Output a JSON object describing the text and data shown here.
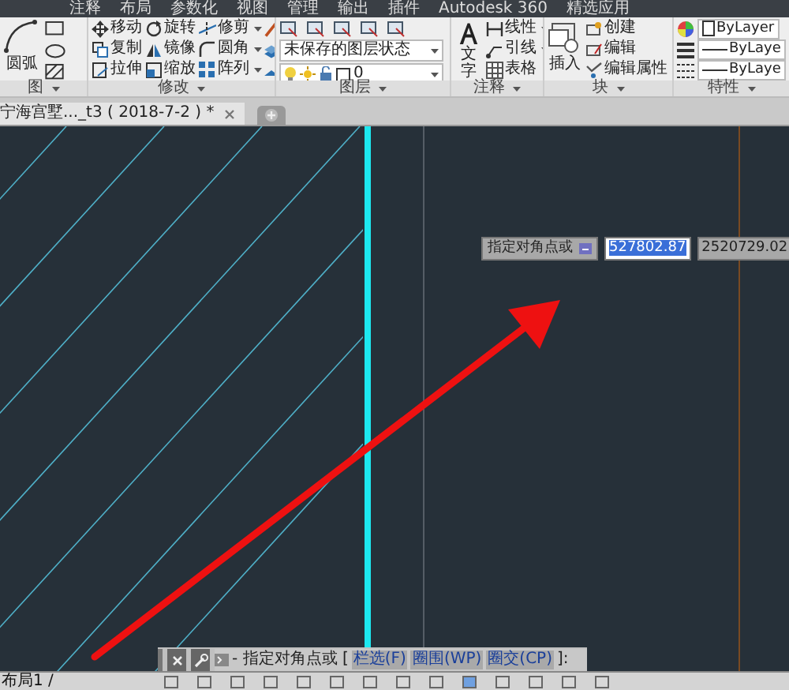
{
  "menu_tabs": [
    "注释",
    "布局",
    "参数化",
    "视图",
    "管理",
    "输出",
    "插件",
    "Autodesk 360",
    "精选应用"
  ],
  "ribbon": {
    "panels": [
      {
        "kind": "draw",
        "title": "图",
        "tools": [
          "圆弧"
        ]
      },
      {
        "kind": "modify",
        "title": "修改",
        "tools": [
          "移动",
          "旋转",
          "修剪",
          "复制",
          "镜像",
          "圆角",
          "拉伸",
          "缩放",
          "阵列"
        ]
      },
      {
        "kind": "layer",
        "title": "图层",
        "state": "未保存的图层状态",
        "layer": "0"
      },
      {
        "kind": "annotation",
        "title": "注释",
        "big": "文字",
        "tools": [
          "线性",
          "引线",
          "表格"
        ]
      },
      {
        "kind": "block",
        "title": "块",
        "big": "插入",
        "tools": [
          "创建",
          "编辑",
          "编辑属性"
        ]
      },
      {
        "kind": "properties",
        "title": "特性",
        "values": [
          "ByLayer",
          "ByLaye",
          "ByLaye"
        ]
      }
    ]
  },
  "document_tabs": [
    {
      "label": "宁海宫墅..._t3 ( 2018-7-2 ) *",
      "selected": true
    }
  ],
  "input_tooltip": {
    "prompt": "指定对角点或",
    "x_value": "527802.87",
    "y_value": "2520729.02"
  },
  "command_line": {
    "prompt": "- 指定对角点或 [",
    "options": [
      "栏选(F)",
      "圈围(WP)",
      "圈交(CP)"
    ],
    "suffix": "]:"
  },
  "layout_tabs": [
    "布局1 /"
  ]
}
